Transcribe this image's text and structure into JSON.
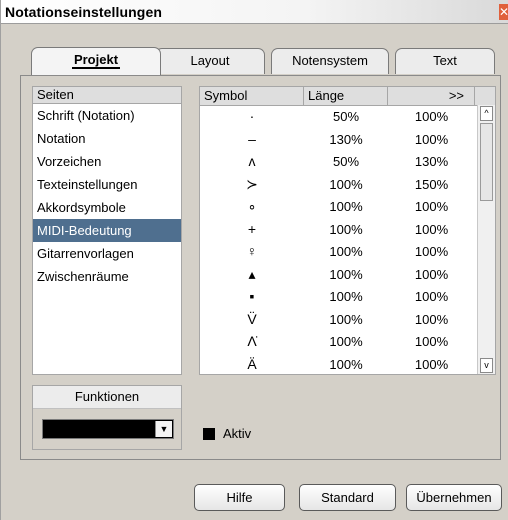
{
  "window": {
    "title": "Notationseinstellungen",
    "close_glyph": "✕"
  },
  "tabs": [
    {
      "label": "Projekt",
      "active": true
    },
    {
      "label": "Layout",
      "active": false
    },
    {
      "label": "Notensystem",
      "active": false
    },
    {
      "label": "Text",
      "active": false
    }
  ],
  "pages": {
    "header": "Seiten",
    "items": [
      "Schrift (Notation)",
      "Notation",
      "Vorzeichen",
      "Texteinstellungen",
      "Akkordsymbole",
      "MIDI-Bedeutung",
      "Gitarrenvorlagen",
      "Zwischenräume"
    ],
    "selected": "MIDI-Bedeutung"
  },
  "table": {
    "columns": [
      "Symbol",
      "Länge",
      ">>"
    ],
    "rows": [
      {
        "symbol": "·",
        "length": "50%",
        "value2": "100%"
      },
      {
        "symbol": "–",
        "length": "130%",
        "value2": "100%"
      },
      {
        "symbol": "ʌ",
        "length": "50%",
        "value2": "130%"
      },
      {
        "symbol": "≻",
        "length": "100%",
        "value2": "150%"
      },
      {
        "symbol": "∘",
        "length": "100%",
        "value2": "100%"
      },
      {
        "symbol": "+",
        "length": "100%",
        "value2": "100%"
      },
      {
        "symbol": "♀",
        "length": "100%",
        "value2": "100%"
      },
      {
        "symbol": "▴",
        "length": "100%",
        "value2": "100%"
      },
      {
        "symbol": "▪",
        "length": "100%",
        "value2": "100%"
      },
      {
        "symbol": "V̈",
        "length": "100%",
        "value2": "100%"
      },
      {
        "symbol": "Λ̇",
        "length": "100%",
        "value2": "100%"
      },
      {
        "symbol": "Ä",
        "length": "100%",
        "value2": "100%"
      }
    ],
    "scroll_up_glyph": "^",
    "scroll_down_glyph": "v"
  },
  "functions": {
    "header": "Funktionen",
    "selected_value": "",
    "arrow_glyph": "▼"
  },
  "aktiv": {
    "label": "Aktiv",
    "checked": true
  },
  "buttons": {
    "help": "Hilfe",
    "default": "Standard",
    "apply": "Übernehmen"
  },
  "colors": {
    "selection": "#4f6f8f",
    "dialog_bg": "#d4d0c8"
  }
}
